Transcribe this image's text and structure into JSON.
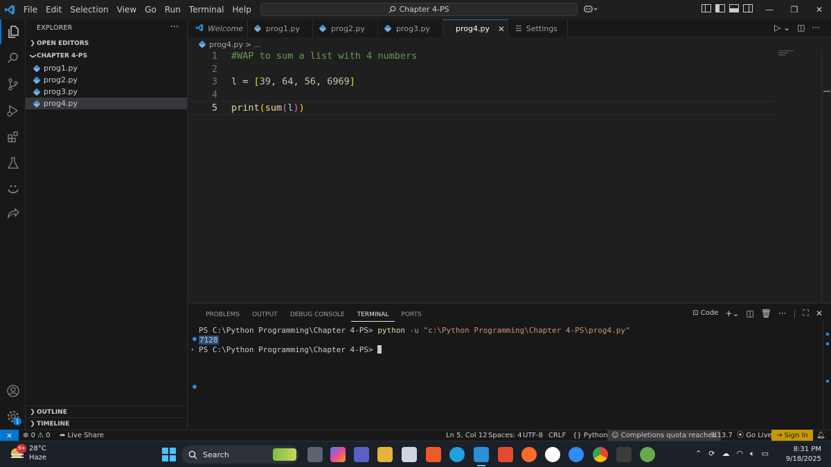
{
  "titlebar": {
    "menu": [
      "File",
      "Edit",
      "Selection",
      "View",
      "Go",
      "Run",
      "Terminal",
      "Help"
    ],
    "search_text": "Chapter 4-PS"
  },
  "sidebar": {
    "title": "EXPLORER",
    "open_editors": "OPEN EDITORS",
    "folder": "CHAPTER 4-PS",
    "files": [
      "prog1.py",
      "prog2.py",
      "prog3.py",
      "prog4.py"
    ],
    "outline": "OUTLINE",
    "timeline": "TIMELINE"
  },
  "activity": {
    "accounts_badge": "1"
  },
  "tabs": [
    {
      "label": "Welcome"
    },
    {
      "label": "prog1.py"
    },
    {
      "label": "prog2.py"
    },
    {
      "label": "prog3.py"
    },
    {
      "label": "prog4.py"
    },
    {
      "label": "Settings"
    }
  ],
  "breadcrumb": {
    "file": "prog4.py",
    "sep": ">",
    "rest": "..."
  },
  "editor": {
    "line_numbers": [
      "1",
      "2",
      "3",
      "4",
      "5"
    ],
    "line1": "#WAP to sum a list with 4 numbers",
    "line3": {
      "var": "l",
      "eq": " = ",
      "open": "[",
      "n1": "39",
      "n2": "64",
      "n3": "56",
      "n4": "6969",
      "comma": ", ",
      "close": "]"
    },
    "line5": {
      "fn1": "print",
      "fn2": "sum",
      "arg": "l"
    }
  },
  "panel": {
    "tabs": [
      "PROBLEMS",
      "OUTPUT",
      "DEBUG CONSOLE",
      "TERMINAL",
      "PORTS"
    ],
    "active_tab": "TERMINAL",
    "shell_label": "Code",
    "prompt": "PS C:\\Python Programming\\Chapter 4-PS>",
    "command": "python",
    "flag": "-u",
    "path_arg": "\"c:\\Python Programming\\Chapter 4-PS\\prog4.py\"",
    "output": "7128"
  },
  "statusbar": {
    "errors": "0",
    "warnings": "0",
    "live_share": "Live Share",
    "position": "Ln 5, Col 12",
    "spaces": "Spaces: 4",
    "encoding": "UTF-8",
    "eol": "CRLF",
    "language": "Python",
    "copilot": "Completions quota reached",
    "python_version": "3.13.7",
    "go_live": "Go Live",
    "sign_in": "Sign In"
  },
  "taskbar": {
    "weather_temp": "28°C",
    "weather_desc": "Haze",
    "weather_badge": "9+",
    "search_label": "Search",
    "time": "8:31 PM",
    "date": "9/18/2025"
  },
  "colors": {
    "accent": "#0078d4",
    "editor_bg": "#1f1f1f",
    "sidebar_bg": "#181818",
    "signin_bg": "#c59a00"
  }
}
